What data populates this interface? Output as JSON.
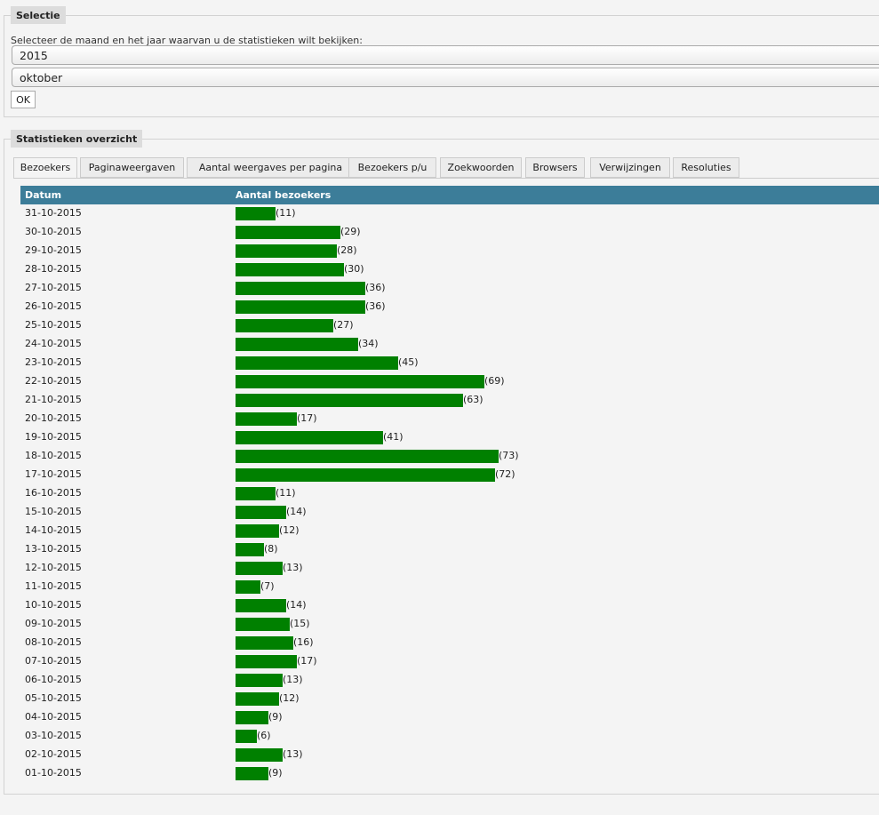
{
  "selectie": {
    "legend": "Selectie",
    "intro": "Selecteer de maand en het jaar waarvan u de statistieken wilt bekijken:",
    "year": "2015",
    "month": "oktober",
    "ok_label": "OK"
  },
  "stats": {
    "legend": "Statistieken overzicht",
    "tabs": [
      {
        "label": "Bezoekers",
        "active": true
      },
      {
        "label": "Paginaweergaven",
        "active": false
      },
      {
        "label": "Aantal weergaves per pagina",
        "active": false
      },
      {
        "label": "Bezoekers p/u",
        "active": false
      },
      {
        "label": "Zoekwoorden",
        "active": false
      },
      {
        "label": "Browsers",
        "active": false
      },
      {
        "label": "Verwijzingen",
        "active": false
      },
      {
        "label": "Resoluties",
        "active": false
      }
    ],
    "columns": {
      "date": "Datum",
      "count": "Aantal bezoekers"
    },
    "bar_color": "#008000",
    "header_color": "#3c7d99"
  },
  "chart_data": {
    "type": "bar",
    "orientation": "horizontal",
    "categories": [
      "31-10-2015",
      "30-10-2015",
      "29-10-2015",
      "28-10-2015",
      "27-10-2015",
      "26-10-2015",
      "25-10-2015",
      "24-10-2015",
      "23-10-2015",
      "22-10-2015",
      "21-10-2015",
      "20-10-2015",
      "19-10-2015",
      "18-10-2015",
      "17-10-2015",
      "16-10-2015",
      "15-10-2015",
      "14-10-2015",
      "13-10-2015",
      "12-10-2015",
      "11-10-2015",
      "10-10-2015",
      "09-10-2015",
      "08-10-2015",
      "07-10-2015",
      "06-10-2015",
      "05-10-2015",
      "04-10-2015",
      "03-10-2015",
      "02-10-2015",
      "01-10-2015"
    ],
    "values": [
      11,
      29,
      28,
      30,
      36,
      36,
      27,
      34,
      45,
      69,
      63,
      17,
      41,
      73,
      72,
      11,
      14,
      12,
      8,
      13,
      7,
      14,
      15,
      16,
      17,
      13,
      12,
      9,
      6,
      13,
      9
    ],
    "xlabel": "Aantal bezoekers",
    "ylabel": "Datum"
  }
}
